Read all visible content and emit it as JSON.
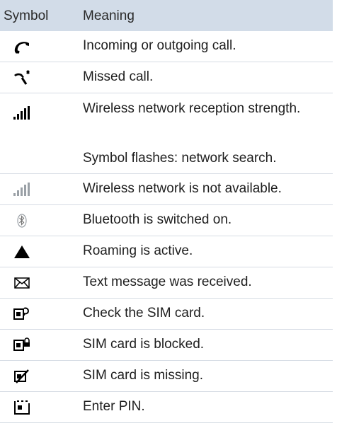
{
  "header": {
    "symbol": "Symbol",
    "meaning": "Meaning"
  },
  "rows": [
    {
      "icon": "phone-call-icon",
      "meaning": "Incoming or outgoing call."
    },
    {
      "icon": "missed-call-icon",
      "meaning": "Missed call."
    },
    {
      "icon": "signal-strength-icon",
      "meaning": "Wireless network reception strength.",
      "extra": "Symbol flashes: network search."
    },
    {
      "icon": "signal-unavailable-icon",
      "meaning": "Wireless network is not available."
    },
    {
      "icon": "bluetooth-icon",
      "meaning": "Bluetooth is switched on."
    },
    {
      "icon": "roaming-triangle-icon",
      "meaning": "Roaming is active."
    },
    {
      "icon": "envelope-icon",
      "meaning": "Text message was received."
    },
    {
      "icon": "sim-check-icon",
      "meaning": "Check the SIM card."
    },
    {
      "icon": "sim-blocked-icon",
      "meaning": "SIM card is blocked."
    },
    {
      "icon": "sim-missing-icon",
      "meaning": "SIM card is missing."
    },
    {
      "icon": "sim-pin-icon",
      "meaning": "Enter PIN."
    }
  ]
}
